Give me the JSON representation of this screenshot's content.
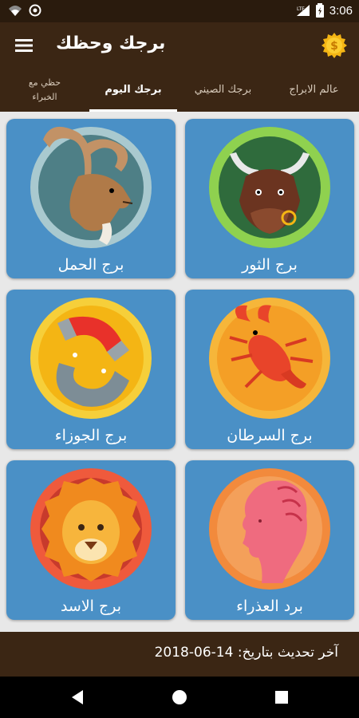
{
  "status_bar": {
    "time": "3:06",
    "network": "LTE"
  },
  "app_bar": {
    "title": "برجك وحظك",
    "menu_icon": "hamburger-menu-icon",
    "coin_icon": "coin-icon"
  },
  "tabs": [
    {
      "label": "عالم الابراج",
      "active": false
    },
    {
      "label": "برجك الصيني",
      "active": false
    },
    {
      "label": "برجك اليوم",
      "active": true
    },
    {
      "label_line1": "حظي مع",
      "label_line2": "الخبراء",
      "active": false
    }
  ],
  "cards": [
    {
      "label": "برج الثور",
      "icon": "taurus-bull-icon",
      "ring": "#8fd14f"
    },
    {
      "label": "برج الحمل",
      "icon": "aries-ram-icon",
      "ring": "#a9c9cf"
    },
    {
      "label": "برج السرطان",
      "icon": "cancer-crab-icon",
      "ring": "#f6b63a"
    },
    {
      "label": "برج الجوزاء",
      "icon": "gemini-magnet-icon",
      "ring": "#f6cf3a"
    },
    {
      "label": "برد العذراء",
      "icon": "virgo-woman-icon",
      "ring": "#f28a3c"
    },
    {
      "label": "برج الاسد",
      "icon": "leo-lion-icon",
      "ring": "#ef5a3c"
    }
  ],
  "footer": {
    "text": "آخر تحديث بتاريخ: 14-06-2018"
  },
  "colors": {
    "bar": "#3b2614",
    "card": "#4a90c6",
    "background": "#e8e8e8"
  }
}
